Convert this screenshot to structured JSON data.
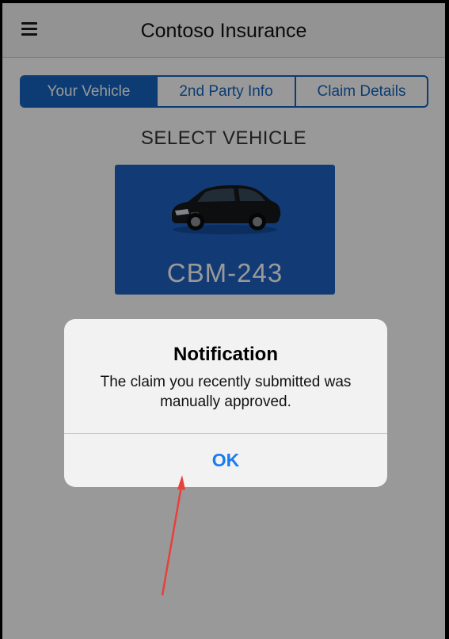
{
  "header": {
    "title": "Contoso Insurance",
    "menu_icon": "hamburger-menu-icon"
  },
  "tabs": [
    {
      "label": "Your Vehicle",
      "active": true
    },
    {
      "label": "2nd Party Info",
      "active": false
    },
    {
      "label": "Claim Details",
      "active": false
    }
  ],
  "section_title": "SELECT VEHICLE",
  "vehicle": {
    "plate": "CBM-243",
    "icon": "car-icon"
  },
  "dialog": {
    "title": "Notification",
    "message": "The claim you recently submitted was manually approved.",
    "ok_label": "OK"
  },
  "annotation": {
    "icon": "arrow-pointer-icon",
    "color": "#e8403a"
  },
  "colors": {
    "accent": "#1565c0",
    "card": "#1e62c2",
    "ok_text": "#1a7cf0"
  }
}
